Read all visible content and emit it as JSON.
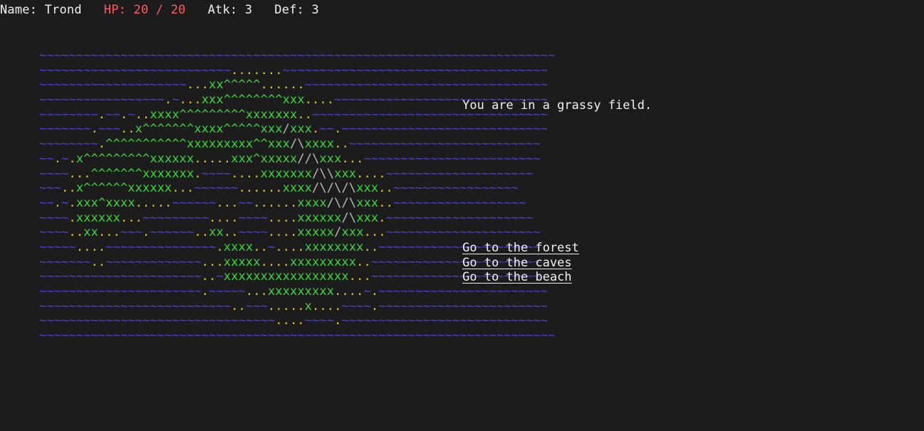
{
  "status": {
    "name": "Name: Trond",
    "hp": "HP: 20 / 20",
    "atk": "Atk: 3",
    "def": "Def: 3"
  },
  "colors": {
    "background": "#1c1c1c",
    "text": "#f2f2f2",
    "hp": "#ff5c5c",
    "water": "#4b3fd6",
    "sand": "#e8c91c",
    "grass": "#3bd63b",
    "mountain": "#b8b8b8"
  },
  "map": {
    "legend": {
      "~": "water",
      ".": "sand",
      "x": "grass",
      "X": "grass",
      "^": "grass",
      "/": "mountain",
      "\\": "mountain"
    },
    "rows": [
      "~~~~~~~~~~~~~~~~~~~~~~~~~~~~~~~~~~~~~~~~~~~~~~~~~~~~~~~~~~~~~~~~~~~~~~",
      "~~~~~~~~~~~~~~~~~~~~~~~~~~.......~~~~~~~~~~~~~~~~~~~~~~~~~~~~~~~~~~~~",
      "~~~~~~~~~~~~~~~~~~~~...xx^^^^^......~~~~~~~~~~~~~~~~~~~~~~~~~~~~~~~~~",
      "~~~~~~~~~~~~~~~~~.~...xxx^^^^^^^^xxx....~~~~~~~~~~~~~~~~~~~~~~~~~~~~~",
      "~~~~~~~~.~~.~..xxxx^^^^^^^^^xxxxxxx..~~~~~~~~~~~~~~~~~~~~~~~~~~~~~~~~",
      "~~~~~~~.~~~..x^^^^^^^xxxx^^^^^xxx/xxx.~~.~~~~~~~~~~~~~~~~~~~~~~~~~~~~",
      "~~~~~~~~.^^^^^^^^^^^xxxxxxxxx^^xxx/\\xxxx..~~~~~~~~~~~~~~~~~~~~~~~~~~",
      "~~.~.x^^^^^^^^^xxxxxx.....xxx^xxxxx//\\xxx...~~~~~~~~~~~~~~~~~~~~~~~~",
      "~~~~...^^^^^^^xxxxxxx.~~~~....xxxxxxx/\\\\xxx....~~~~~~~~~~~~~~~~~~~~",
      "~~~..x^^^^^^xxxxxx...~~~~~~......xxxx/\\/\\/\\xxx..~~~~~~~~~~~~~~~~~",
      "~~.~.xxx^xxxx.....~~~~~~...~~......xxxx/\\/\\xxx..~~~~~~~~~~~~~~~~~~",
      "~~~~.xxxxxx...~~~~~~~~~....~~~~....xxxxxx/\\xxx.~~~~~~~~~~~~~~~~~~~~",
      "~~~~..xx...~~~.~~~~~~..xx..~~~~....xxxxx/xxx...~~~~~~~~~~~~~~~~~~~~~",
      "~~~~~....~~~~~~~~~~~~~~~.xxxx..~....xxxxxxxx..~~~~~~~~~~~~~~~~~~~~~~",
      "~~~~~~~..~~~~~~~~~~~~~...xxxxx....xxxxxxxxx..~~~~~~~~~~~~~~~~~~~~~~~",
      "~~~~~~~~~~~~~~~~~~~~~~..~xxxxxxxxxxxxxxxxx...~~~~~~~~~~~~~~~~~~~~~~~",
      "~~~~~~~~~~~~~~~~~~~~~~.~~~~~...xxxxxxxxx....~.~~~~~~~~~~~~~~~~~~~~~~~",
      "~~~~~~~~~~~~~~~~~~~~~~~~~~..~~~.....x....~~~~.~~~~~~~~~~~~~~~~~~~~~~~",
      "~~~~~~~~~~~~~~~~~~~~~~~~~~~~~~~~....~~~~.~~~~~~~~~~~~~~~~~~~~~~~~~~~~",
      "~~~~~~~~~~~~~~~~~~~~~~~~~~~~~~~~~~~~~~~~~~~~~~~~~~~~~~~~~~~~~~~~~~~~~~"
    ]
  },
  "location": {
    "description": "You are in a grassy field."
  },
  "actions": [
    {
      "label": "Go to the forest"
    },
    {
      "label": "Go to the caves"
    },
    {
      "label": "Go to the beach"
    }
  ]
}
